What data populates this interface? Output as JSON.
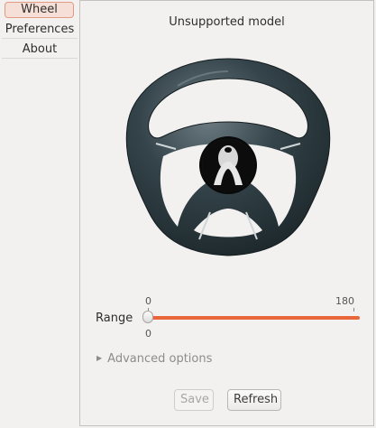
{
  "sidebar": {
    "items": [
      {
        "label": "Wheel",
        "active": true
      },
      {
        "label": "Preferences",
        "active": false
      },
      {
        "label": "About",
        "active": false
      }
    ]
  },
  "main": {
    "title": "Unsupported model",
    "range": {
      "label": "Range",
      "min_label": "0",
      "max_label": "180",
      "value_label": "0",
      "value": 0,
      "accent_color": "#e8663a"
    },
    "advanced_label": "Advanced options",
    "save_label": "Save",
    "refresh_label": "Refresh"
  }
}
